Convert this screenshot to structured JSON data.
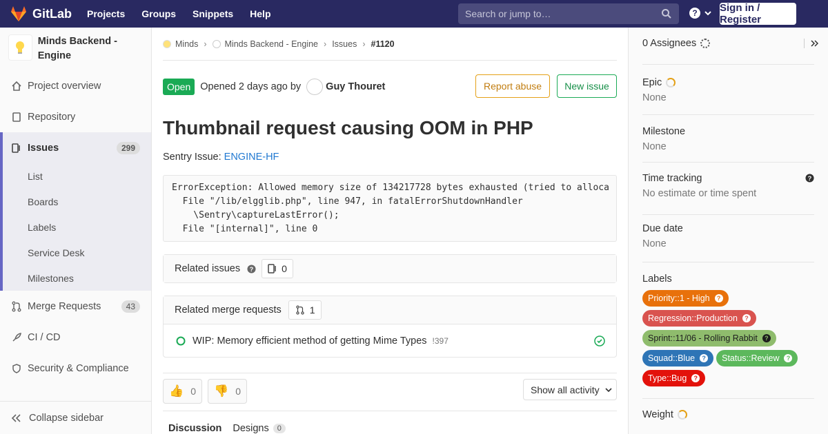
{
  "navbar": {
    "brand": "GitLab",
    "links": [
      "Projects",
      "Groups",
      "Snippets",
      "Help"
    ],
    "search_placeholder": "Search or jump to…",
    "signin": "Sign in / Register"
  },
  "sidebar": {
    "project_name": "Minds Backend - Engine",
    "items": [
      {
        "label": "Project overview",
        "icon": "home-icon"
      },
      {
        "label": "Repository",
        "icon": "doc-icon"
      },
      {
        "label": "Issues",
        "icon": "issues-icon",
        "count": "299"
      },
      {
        "label": "Merge Requests",
        "icon": "merge-request-icon",
        "count": "43"
      },
      {
        "label": "CI / CD",
        "icon": "rocket-icon"
      },
      {
        "label": "Security & Compliance",
        "icon": "shield-icon"
      }
    ],
    "issue_subitems": [
      "List",
      "Boards",
      "Labels",
      "Service Desk",
      "Milestones"
    ],
    "collapse": "Collapse sidebar"
  },
  "breadcrumbs": [
    "Minds",
    "Minds Backend - Engine",
    "Issues",
    "#1120"
  ],
  "issue": {
    "status": "Open",
    "opened_text": "Opened 2 days ago by",
    "author": "Guy Thouret",
    "report_abuse": "Report abuse",
    "new_issue": "New issue",
    "title": "Thumbnail request causing OOM in PHP",
    "desc_prefix": "Sentry Issue:",
    "desc_link": "ENGINE-HF",
    "code": "ErrorException: Allowed memory size of 134217728 bytes exhausted (tried to alloca\n  File \"/lib/elgglib.php\", line 947, in fatalErrorShutdownHandler\n    \\Sentry\\captureLastError();\n  File \"[internal]\", line 0"
  },
  "related_issues": {
    "label": "Related issues",
    "count": "0"
  },
  "related_mrs": {
    "label": "Related merge requests",
    "count": "1",
    "items": [
      {
        "title": "WIP: Memory efficient method of getting Mime Types",
        "ref": "!397"
      }
    ]
  },
  "awards": {
    "thumbsup": "0",
    "thumbsdown": "0"
  },
  "activity": "Show all activity",
  "tabs": [
    {
      "label": "Discussion"
    },
    {
      "label": "Designs",
      "count": "0"
    }
  ],
  "right": {
    "assignees": "0 Assignees",
    "epic_title": "Epic",
    "epic_value": "None",
    "milestone_title": "Milestone",
    "milestone_value": "None",
    "time_title": "Time tracking",
    "time_value": "No estimate or time spent",
    "due_title": "Due date",
    "due_value": "None",
    "labels_title": "Labels",
    "labels": [
      {
        "text": "Priority::1 - High",
        "color": "#e8710b"
      },
      {
        "text": "Regression::Production",
        "color": "#d9534f"
      },
      {
        "text": "Sprint::11/06 - Rolling Rabbit",
        "color": "#8fbc6d"
      },
      {
        "text": "Squad::Blue",
        "color": "#2e75b6"
      },
      {
        "text": "Status::Review",
        "color": "#5cb85c"
      },
      {
        "text": "Type::Bug",
        "color": "#e3120b"
      }
    ],
    "weight_title": "Weight"
  }
}
